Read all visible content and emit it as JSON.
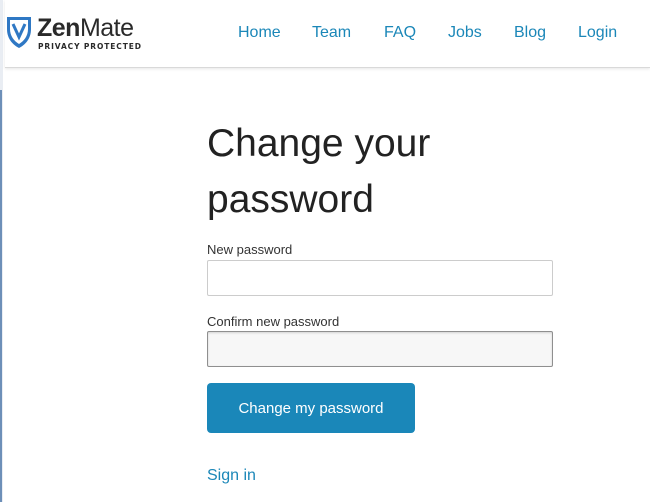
{
  "brand": {
    "name_bold": "Zen",
    "name_regular": "Mate",
    "tagline": "PRIVACY PROTECTED",
    "logo_icon": "shield-icon"
  },
  "nav": {
    "items": [
      {
        "label": "Home"
      },
      {
        "label": "Team"
      },
      {
        "label": "FAQ"
      },
      {
        "label": "Jobs"
      },
      {
        "label": "Blog"
      },
      {
        "label": "Login"
      }
    ]
  },
  "form": {
    "title": "Change your password",
    "new_password": {
      "label": "New password",
      "value": ""
    },
    "confirm_password": {
      "label": "Confirm new password",
      "value": ""
    },
    "submit_label": "Change my password",
    "sign_in_label": "Sign in"
  },
  "colors": {
    "accent": "#1a87b9",
    "link": "#1b87b8",
    "text": "#222222",
    "logo_blue": "#2f78c4"
  }
}
